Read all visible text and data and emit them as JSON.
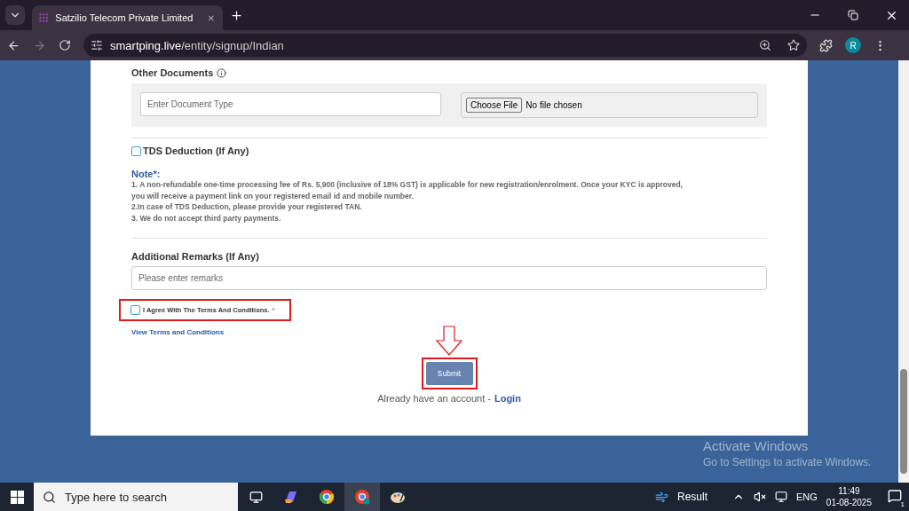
{
  "browser": {
    "tab_title": "Satzilio Telecom Private Limited",
    "url_host": "smartping.live",
    "url_path": "/entity/signup/Indian",
    "profile": "R"
  },
  "form": {
    "other_documents": {
      "label": "Other Documents",
      "type_placeholder": "Enter Document Type",
      "file_button": "Choose File",
      "file_status": "No file chosen"
    },
    "tds": {
      "label": "TDS Deduction (If Any)",
      "checked": false
    },
    "note": {
      "title": "Note*:",
      "lines": [
        "1. A non-refundable one-time processing fee of Rs. 5,900 (inclusive of 18% GST) is applicable for new registration/enrolment. Once your KYC is approved, you will receive a payment link on your registered email id and mobile number.",
        "2.In case of TDS Deduction, please provide your registered TAN.",
        "3. We do not accept third party payments."
      ]
    },
    "remarks": {
      "label": "Additional Remarks (If Any)",
      "placeholder": "Please enter remarks"
    },
    "agree": {
      "label": "I Agree With The Terms And Conditions.",
      "required": "*",
      "checked": false
    },
    "terms_link": "View Terms and Conditions",
    "submit": "Submit",
    "login_prompt": "Already have an account -",
    "login_link": "Login"
  },
  "watermark": {
    "title": "Activate Windows",
    "subtitle": "Go to Settings to activate Windows."
  },
  "taskbar": {
    "search_placeholder": "Type here to search",
    "weather": "Result",
    "language": "ENG",
    "time": "11:49",
    "date": "01-08-2025",
    "notifications": "1"
  }
}
